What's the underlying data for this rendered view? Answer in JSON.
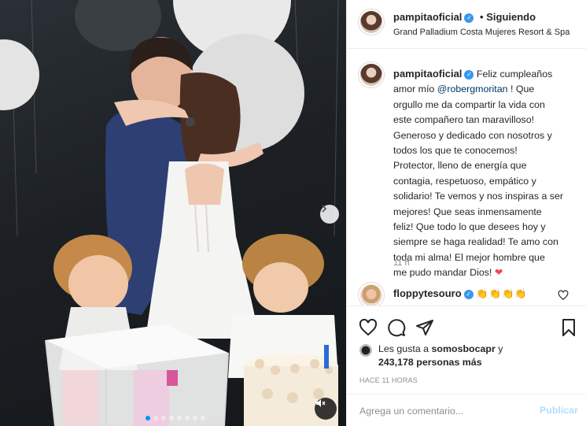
{
  "post": {
    "username": "pampitaoficial",
    "follow_dot": "•",
    "follow_label": "Siguiendo",
    "location": "Grand Palladium Costa Mujeres Resort & Spa",
    "caption_lines": [
      "Feliz cumpleaños",
      "amor mío",
      "@robergmoritan",
      "! Que",
      "orgullo me da compartir la vida con",
      "este compañero tan maravilloso!",
      "Generoso y dedicado con nosotros y",
      "todos los que te conocemos!",
      "Protector, lleno de energía que",
      "contagia, respetuoso, empático y",
      "solidario! Te vemos y nos inspiras a ser",
      "mejores! Que seas inmensamente",
      "feliz! Que todo lo que desees hoy y",
      "siempre se haga realidad! Te amo con",
      "toda mi alma! El mejor hombre que",
      "me pudo mandar Dios!",
      "❤"
    ],
    "caption_age": "11 h",
    "comment": {
      "username": "floppytesouro",
      "text": "👏👏👏👏"
    },
    "likes": {
      "prefix": "Les gusta a",
      "user": "somosbocapr",
      "joiner": "y",
      "count": "243,178",
      "suffix": "personas más"
    },
    "timestamp": "HACE 11 HORAS",
    "comment_placeholder": "Agrega un comentario...",
    "publish_label": "Publicar"
  },
  "carousel": {
    "count": 8,
    "active": 0
  },
  "colors": {
    "accent": "#0095f6",
    "verified": "#3897f0",
    "mention": "#00376b",
    "publish_disabled": "#b2dffc",
    "heart": "#ed4956"
  }
}
